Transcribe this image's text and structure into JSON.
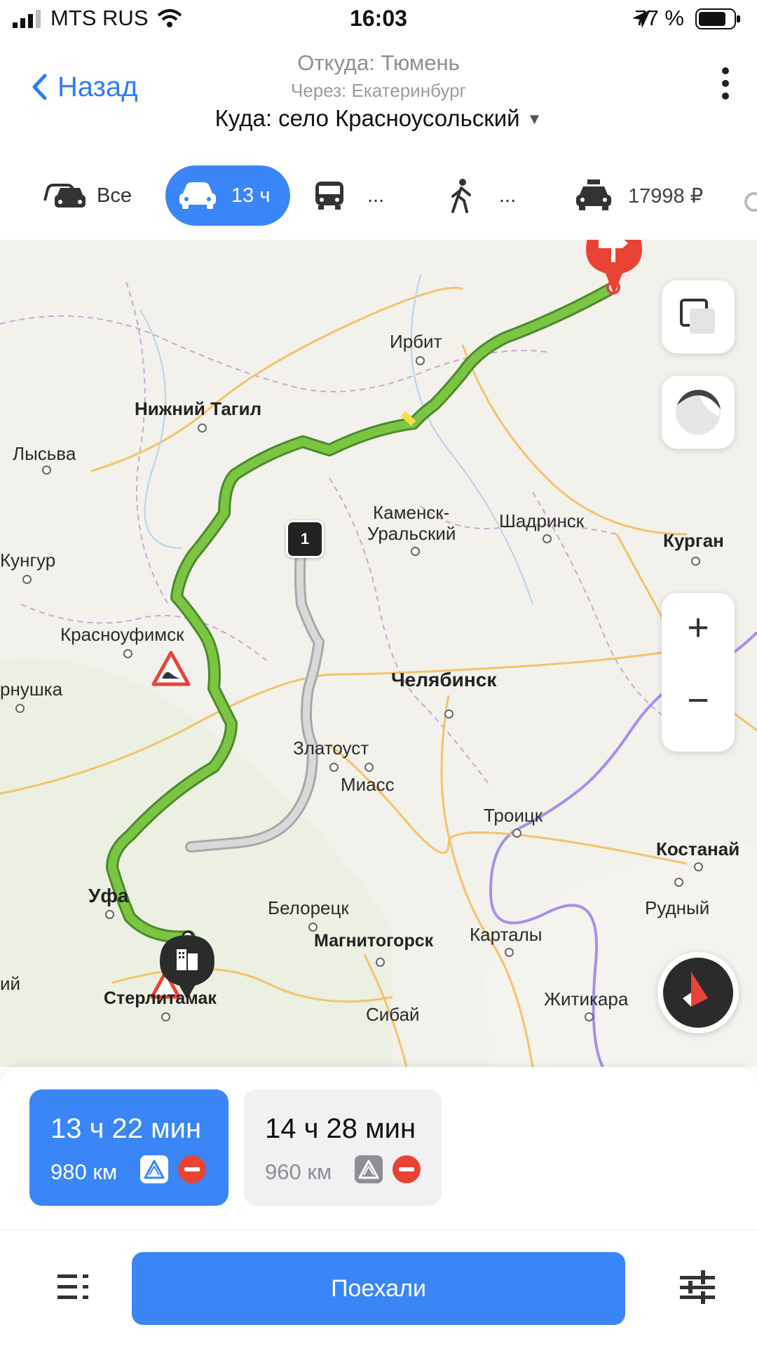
{
  "status": {
    "carrier": "MTS RUS",
    "time": "16:03",
    "battery": "77 %"
  },
  "header": {
    "back_label": "Назад",
    "from": "Откуда: Тюмень",
    "via": "Через: Екатеринбург",
    "to": "Куда: село Красноусольский",
    "to_caret": "▼"
  },
  "transport_tabs": [
    {
      "icon": "cars-icon",
      "label": "Все"
    },
    {
      "icon": "car-icon",
      "label": "13 ч",
      "active": true
    },
    {
      "icon": "bus-icon",
      "label": "..."
    },
    {
      "icon": "pedestrian-icon",
      "label": "..."
    },
    {
      "icon": "taxi-icon",
      "label": "17998 ₽"
    }
  ],
  "map": {
    "cities": [
      {
        "name": "Ирбит"
      },
      {
        "name": "Нижний Тагил"
      },
      {
        "name": "Лысьва"
      },
      {
        "name": "Кунгур"
      },
      {
        "name": "Каменск-"
      },
      {
        "name": "Уральский"
      },
      {
        "name": "Шадринск"
      },
      {
        "name": "Курган"
      },
      {
        "name": "Красноуфимск"
      },
      {
        "name": "рнушка"
      },
      {
        "name": "Челябинск"
      },
      {
        "name": "Златоуст"
      },
      {
        "name": "Миасс"
      },
      {
        "name": "Троицк"
      },
      {
        "name": "Костанай"
      },
      {
        "name": "Уфа"
      },
      {
        "name": "Белорецк"
      },
      {
        "name": "Рудный"
      },
      {
        "name": "Магнитогорск"
      },
      {
        "name": "Карталы"
      },
      {
        "name": "Стерлитамак"
      },
      {
        "name": "Сибай"
      },
      {
        "name": "Житикара"
      },
      {
        "name": "ий"
      }
    ],
    "route_marker_number": "1",
    "zoom_in": "+",
    "zoom_out": "−"
  },
  "routes": [
    {
      "time": "13 ч 22 мин",
      "distance": "980 км",
      "selected": true
    },
    {
      "time": "14 ч 28 мин",
      "distance": "960 км",
      "selected": false
    }
  ],
  "actions": {
    "go_label": "Поехали"
  },
  "colors": {
    "accent": "#3a86f7",
    "route_primary": "#7cc543",
    "route_alt": "#b8b8b8",
    "destination_pin": "#e94335"
  }
}
